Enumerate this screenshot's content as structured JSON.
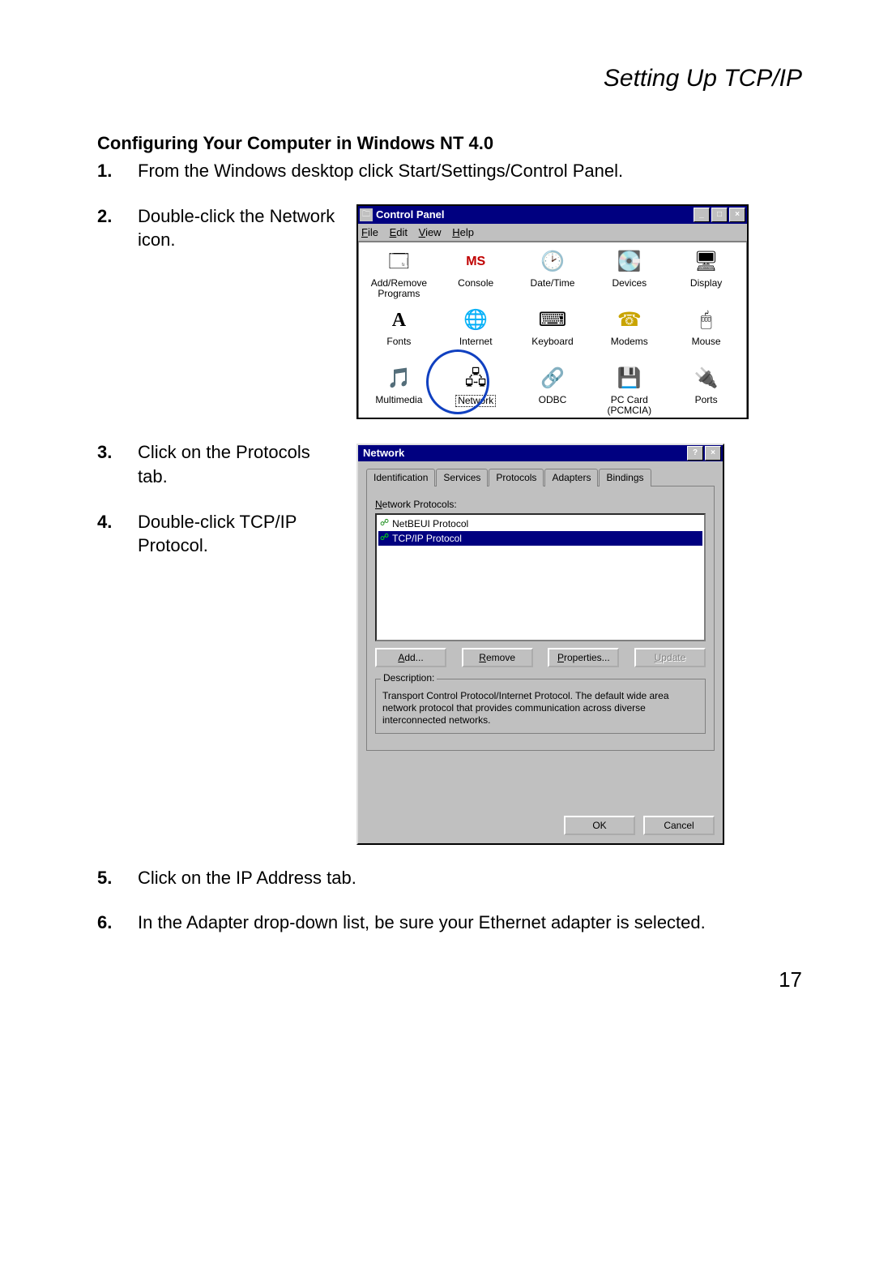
{
  "header": "Setting Up TCP/IP",
  "section_title": "Configuring Your Computer in Windows NT 4.0",
  "steps": [
    {
      "n": "1.",
      "t": "From the Windows desktop click Start/Settings/Control Panel."
    },
    {
      "n": "2.",
      "t": "Double-click the Network icon."
    },
    {
      "n": "3.",
      "t": "Click on the Protocols tab."
    },
    {
      "n": "4.",
      "t": "Double-click TCP/IP Protocol."
    },
    {
      "n": "5.",
      "t": "Click on the IP Address tab."
    },
    {
      "n": "6.",
      "t": "In the Adapter drop-down list, be sure your Ethernet adapter is selected."
    }
  ],
  "cp": {
    "title": "Control Panel",
    "menus": [
      "File",
      "Edit",
      "View",
      "Help"
    ],
    "items": [
      {
        "label": "Add/Remove Programs",
        "glyph": "🗔"
      },
      {
        "label": "Console",
        "glyph": "MS"
      },
      {
        "label": "Date/Time",
        "glyph": "🕑"
      },
      {
        "label": "Devices",
        "glyph": "💽"
      },
      {
        "label": "Display",
        "glyph": "🖥"
      },
      {
        "label": "Fonts",
        "glyph": "A"
      },
      {
        "label": "Internet",
        "glyph": "🌐"
      },
      {
        "label": "Keyboard",
        "glyph": "⌨"
      },
      {
        "label": "Modems",
        "glyph": "☎"
      },
      {
        "label": "Mouse",
        "glyph": "🖱"
      },
      {
        "label": "Multimedia",
        "glyph": "🎵"
      },
      {
        "label": "Network",
        "glyph": "🖧"
      },
      {
        "label": "ODBC",
        "glyph": "🔗"
      },
      {
        "label": "PC Card (PCMCIA)",
        "glyph": "💾"
      },
      {
        "label": "Ports",
        "glyph": "🔌"
      }
    ]
  },
  "network_dialog": {
    "title": "Network",
    "tabs": [
      "Identification",
      "Services",
      "Protocols",
      "Adapters",
      "Bindings"
    ],
    "active_tab": "Protocols",
    "list_label": "Network Protocols:",
    "protocols": [
      {
        "name": "NetBEUI Protocol",
        "selected": false
      },
      {
        "name": "TCP/IP Protocol",
        "selected": true
      }
    ],
    "buttons": {
      "add": "Add...",
      "remove": "Remove",
      "properties": "Properties...",
      "update": "Update"
    },
    "desc_label": "Description:",
    "description": "Transport Control Protocol/Internet Protocol. The default wide area network protocol that provides communication across diverse interconnected networks.",
    "ok": "OK",
    "cancel": "Cancel"
  },
  "page_number": "17"
}
